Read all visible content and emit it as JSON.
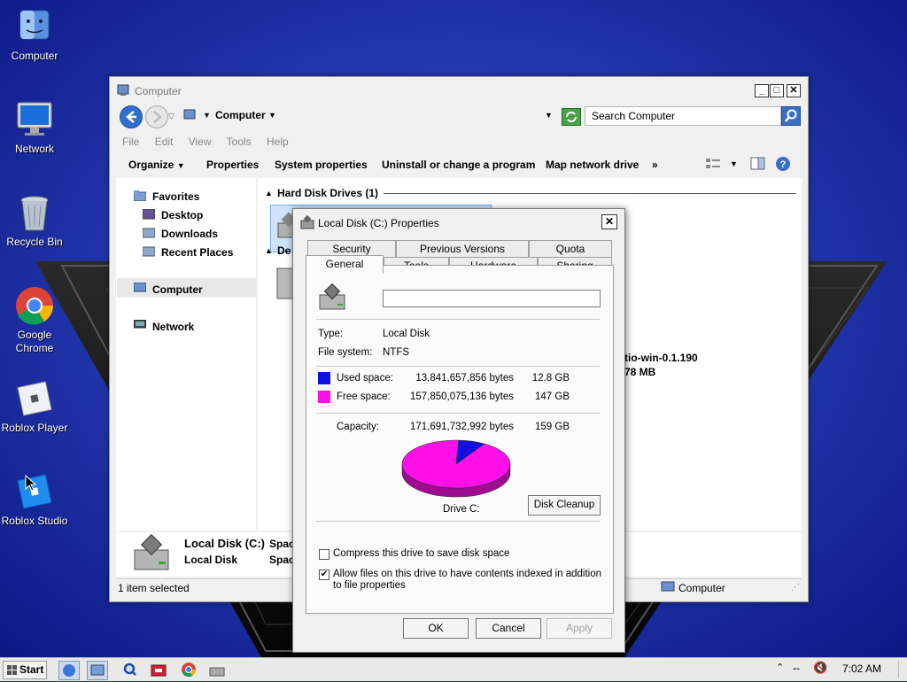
{
  "desktop": {
    "icons": [
      {
        "label": "Computer"
      },
      {
        "label": "Network"
      },
      {
        "label": "Recycle Bin"
      },
      {
        "label": "Google Chrome"
      },
      {
        "label": "Roblox Player"
      },
      {
        "label": "Roblox Studio"
      }
    ]
  },
  "explorer": {
    "title": "Computer",
    "address": "Computer",
    "search_placeholder": "Search Computer",
    "menu": [
      "File",
      "Edit",
      "View",
      "Tools",
      "Help"
    ],
    "commands": [
      "Organize",
      "Properties",
      "System properties",
      "Uninstall or change a program",
      "Map network drive"
    ],
    "more_commands": "»",
    "nav": {
      "favorites": "Favorites",
      "desktop": "Desktop",
      "downloads": "Downloads",
      "recent": "Recent Places",
      "computer": "Computer",
      "network": "Network"
    },
    "groups": {
      "hard_disks": "Hard Disk Drives (1)",
      "removable_partial": "De"
    },
    "cd_drive": {
      "name_partial": "tio-win-0.1.190",
      "size_partial": "78 MB"
    },
    "details": {
      "name": "Local Disk (C:)",
      "type": "Local Disk",
      "space_label_1": "Spac",
      "space_label_2": "Spac"
    },
    "status_left": "1 item selected",
    "status_right": "Computer"
  },
  "properties": {
    "title": "Local Disk (C:) Properties",
    "tabs_row1": [
      "Security",
      "Previous Versions",
      "Quota"
    ],
    "tabs_row2": [
      "General",
      "Tools",
      "Hardware",
      "Sharing"
    ],
    "active_tab": "General",
    "volume_label": "",
    "type_label": "Type:",
    "type_value": "Local Disk",
    "fs_label": "File system:",
    "fs_value": "NTFS",
    "used_label": "Used space:",
    "used_bytes": "13,841,657,856 bytes",
    "used_gb": "12.8 GB",
    "free_label": "Free space:",
    "free_bytes": "157,850,075,136 bytes",
    "free_gb": "147 GB",
    "capacity_label": "Capacity:",
    "capacity_bytes": "171,691,732,992 bytes",
    "capacity_gb": "159 GB",
    "used_fraction": 0.0806,
    "used_color": "#1010e0",
    "free_color": "#ff10e8",
    "drive_label": "Drive C:",
    "disk_cleanup": "Disk Cleanup",
    "compress_label": "Compress this drive to save disk space",
    "compress_checked": false,
    "index_label": "Allow files on this drive to have contents indexed in addition to file properties",
    "index_checked": true,
    "ok": "OK",
    "cancel": "Cancel",
    "apply": "Apply"
  },
  "taskbar": {
    "start": "Start",
    "clock": "7:02 AM"
  }
}
